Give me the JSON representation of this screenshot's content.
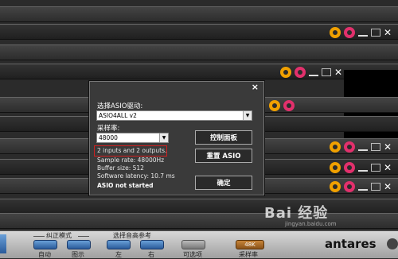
{
  "dialog": {
    "driver_label": "选择ASIO驱动:",
    "driver_value": "ASIO4ALL v2",
    "rate_label": "采样率:",
    "rate_value": "48000",
    "control_panel": "控制面板",
    "reset_asio": "重置 ASIO",
    "ok": "确定",
    "io_info": "2 inputs and 2 outputs.",
    "sample_rate": "Sample rate: 48000Hz",
    "buffer_size": "Buffer size: 512",
    "latency": "Software latency: 10.7 ms",
    "status": "ASIO not started",
    "close": "×"
  },
  "bottom_bar": {
    "group1_label": "纠正模式",
    "auto": "自动",
    "graph": "图示",
    "group2_label": "选择音高参考",
    "left": "左",
    "right": "右",
    "optional": "可选项",
    "rate_pill": "48K",
    "rate_btn": "采样率",
    "brand": "antares"
  },
  "watermark": {
    "text": "Bai 经验",
    "url": "jingyan.baidu.com"
  },
  "icons": {
    "plugin": "plugin-icon",
    "power": "power-icon",
    "window_close": "close-icon"
  },
  "colors": {
    "accent_orange": "#f0a000",
    "accent_pink": "#e2306c",
    "highlight_red": "#d02020"
  }
}
